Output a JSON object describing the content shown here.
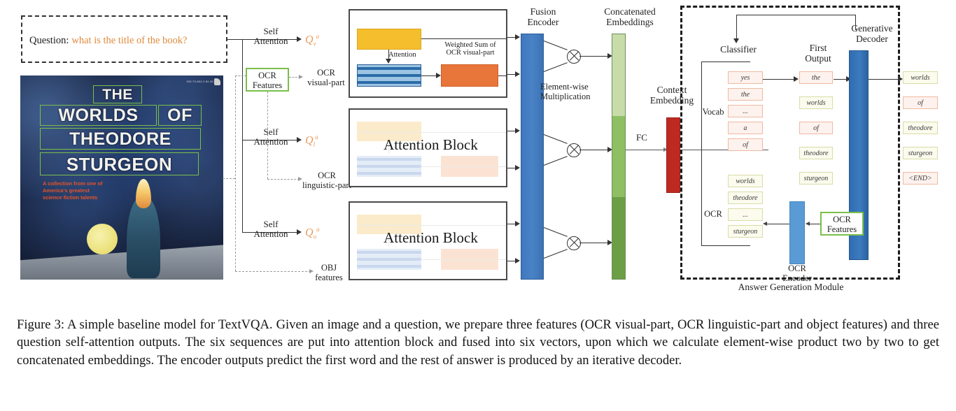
{
  "figure": {
    "caption": "Figure 3: A simple baseline model for TextVQA. Given an image and a question, we prepare three features (OCR visual-part, OCR linguistic-part and object features) and three question self-attention outputs. The six sequences are put into attention block and fused into six vectors, upon which we calculate element-wise product two by two to get concatenated embeddings. The encoder outputs predict the first word and the rest of answer is produced by an iterative decoder."
  },
  "question": {
    "label": "Question:",
    "text": "what is the title of the book?"
  },
  "book_cover": {
    "title_lines": [
      "THE",
      "WORLDS OF",
      "THEODORE",
      "STURGEON"
    ],
    "subtitle": "A collection from one of\nAmerica's greatest\nscience fiction talents",
    "barcode_text": "905 70-802-0 $1.50"
  },
  "pipeline": {
    "self_attention_1": "Self\nAttention",
    "self_attention_2": "Self\nAttention",
    "self_attention_3": "Self\nAttention",
    "q_visual": "Q",
    "q_visual_sub": "v",
    "q_ling": "Q",
    "q_ling_sub": "l",
    "q_obj": "Q",
    "q_obj_sub": "o",
    "q_sup": "a",
    "ocr_features": "OCR\nFeatures",
    "ocr_visual_part": "OCR\nvisual-part",
    "ocr_linguistic_part": "OCR\nlinguistic-part",
    "obj_features": "OBJ\nfeatures"
  },
  "attention": {
    "inner_attention_label": "Attention",
    "weighted_sum_label": "Weighted Sum of\nOCR visual-part",
    "block_label_1": "Attention Block",
    "block_label_2": "Attention Block"
  },
  "fusion": {
    "encoder_label": "Fusion\nEncoder",
    "elementwise_label": "Element-wise\nMultiplication",
    "concat_label": "Concatenated\nEmbeddings",
    "fc_label": "FC",
    "context_label": "Context\nEmbedding"
  },
  "answer_module": {
    "title": "Answer Generation Module",
    "classifier_label": "Classifier",
    "first_output_label": "First\nOutput",
    "generative_decoder_label": "Generative\nDecoder",
    "vocab_label": "Vocab",
    "ocr_label": "OCR",
    "ocr_encoder_label": "OCR\nEncoder",
    "ocr_features_label": "OCR\nFeatures",
    "classifier_vocab_items": [
      "yes",
      "the",
      "...",
      "a",
      "of"
    ],
    "classifier_ocr_items": [
      "worlds",
      "theodore",
      "...",
      "sturgeon"
    ],
    "first_output_items": [
      {
        "text": "the",
        "kind": "vocab"
      },
      {
        "text": "worlds",
        "kind": "ocr"
      },
      {
        "text": "of",
        "kind": "vocab"
      },
      {
        "text": "theodore",
        "kind": "ocr"
      },
      {
        "text": "sturgeon",
        "kind": "ocr"
      }
    ],
    "decoder_output_items": [
      {
        "text": "worlds",
        "kind": "ocr"
      },
      {
        "text": "of",
        "kind": "vocab"
      },
      {
        "text": "theodore",
        "kind": "ocr"
      },
      {
        "text": "sturgeon",
        "kind": "ocr"
      },
      {
        "text": "<END>",
        "kind": "vocab"
      }
    ]
  },
  "colors": {
    "accent_orange": "#E08A3C",
    "ocr_green": "#7BBF4A",
    "fusion_blue": "#3F78BE",
    "concat_green": "#6FA24A",
    "context_red": "#BE2A20",
    "decoder_blue": "#2F6DB2",
    "ocr_encoder_blue": "#5B9BD5",
    "yellow_box": "#F5BE2D",
    "orange_box": "#E8763A"
  }
}
